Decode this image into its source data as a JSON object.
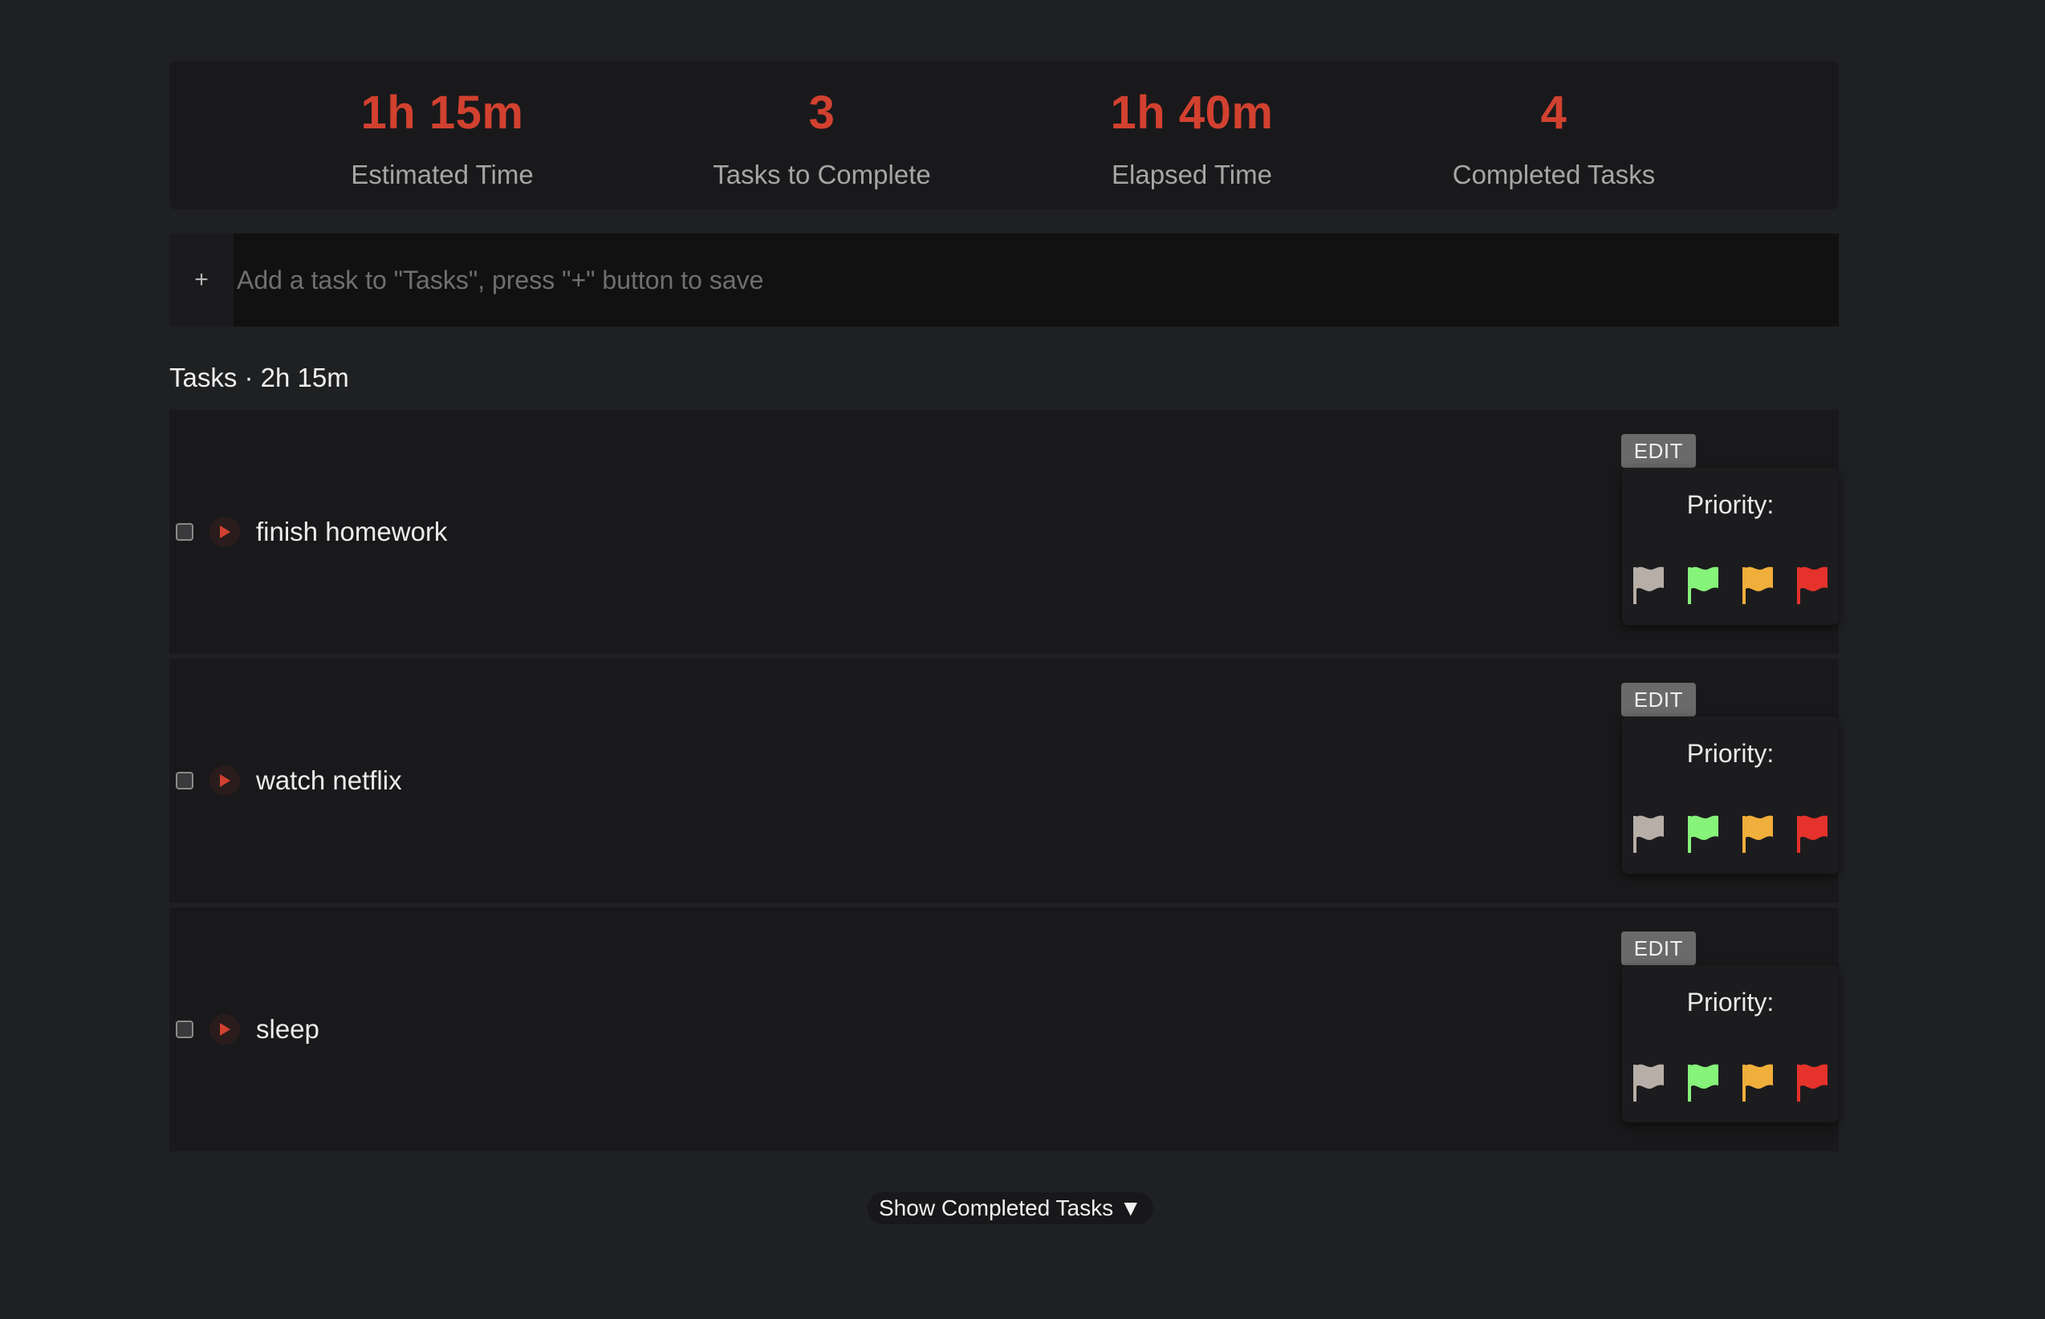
{
  "stats": [
    {
      "value": "1h 15m",
      "label": "Estimated Time"
    },
    {
      "value": "3",
      "label": "Tasks to Complete"
    },
    {
      "value": "1h 40m",
      "label": "Elapsed Time"
    },
    {
      "value": "4",
      "label": "Completed Tasks"
    }
  ],
  "add_task": {
    "plus_label": "+",
    "placeholder": "Add a task to \"Tasks\", press \"+\" button to save",
    "value": ""
  },
  "section": {
    "title": "Tasks · 2h 15m"
  },
  "tasks": [
    {
      "name": "finish homework",
      "edit_label": "EDIT",
      "priority_label": "Priority:",
      "checked": false
    },
    {
      "name": "watch netflix",
      "edit_label": "EDIT",
      "priority_label": "Priority:",
      "checked": false
    },
    {
      "name": "sleep",
      "edit_label": "EDIT",
      "priority_label": "Priority:",
      "checked": false
    }
  ],
  "priority_flags": [
    {
      "icon": "flag-none-icon",
      "color": "#b7aea7"
    },
    {
      "icon": "flag-low-icon",
      "color": "#86f37a"
    },
    {
      "icon": "flag-medium-icon",
      "color": "#f0ae3a"
    },
    {
      "icon": "flag-high-icon",
      "color": "#e5322b"
    }
  ],
  "footer": {
    "show_completed_label": "Show Completed Tasks ▼"
  },
  "colors": {
    "accent": "#d2412f",
    "background": "#1f2022",
    "panel": "#19191b"
  }
}
